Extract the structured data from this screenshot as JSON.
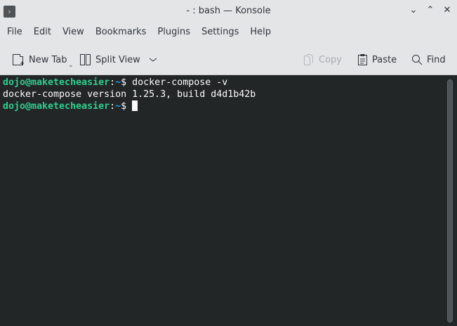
{
  "window": {
    "title": "- : bash — Konsole",
    "icons": [
      "terminal-app-icon",
      "minimize-icon",
      "maximize-icon",
      "close-icon"
    ]
  },
  "menu": [
    "File",
    "Edit",
    "View",
    "Bookmarks",
    "Plugins",
    "Settings",
    "Help"
  ],
  "toolbar": {
    "new_tab": "New Tab",
    "split_view": "Split View",
    "copy": "Copy",
    "paste": "Paste",
    "find": "Find"
  },
  "terminal": {
    "lines": [
      {
        "user": "dojo@maketecheasier",
        "sep": ":",
        "path": "~",
        "prompt": "$ ",
        "cmd": "docker-compose -v"
      },
      {
        "output": "docker-compose version 1.25.3, build d4d1b42b"
      },
      {
        "user": "dojo@maketecheasier",
        "sep": ":",
        "path": "~",
        "prompt": "$ ",
        "cmd": ""
      }
    ]
  }
}
